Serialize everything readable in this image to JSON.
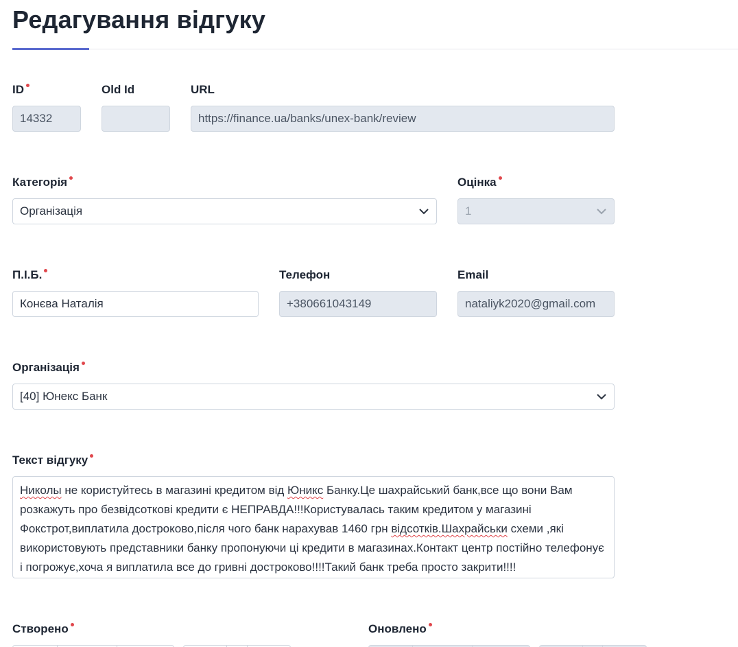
{
  "page": {
    "title": "Редагування відгуку"
  },
  "fields": {
    "id": {
      "label": "ID",
      "value": "14332"
    },
    "old_id": {
      "label": "Old Id",
      "value": ""
    },
    "url": {
      "label": "URL",
      "value": "https://finance.ua/banks/unex-bank/review"
    },
    "category": {
      "label": "Категорія",
      "value": "Організація"
    },
    "rating": {
      "label": "Оцінка",
      "value": "1"
    },
    "name": {
      "label": "П.І.Б.",
      "value": "Конєва Наталія"
    },
    "phone": {
      "label": "Телефон",
      "value": "+380661043149"
    },
    "email": {
      "label": "Email",
      "value": "nataliyk2020@gmail.com"
    },
    "organization": {
      "label": "Організація",
      "value": "[40] Юнекс Банк"
    },
    "review_text": {
      "label": "Текст відгуку",
      "w1": "Николы",
      "t1": " не користуйтесь в магазині кредитом від ",
      "w2": "Юникс",
      "t2": " Банку.Це шахрайський банк,все що вони Вам розкажуть про безвідсоткові кредити  є НЕПРАВДА!!!Користувалась таким кредитом у магазині Фокстрот,виплатила достроково,після чого банк нарахував 1460 грн ",
      "w3": "відсотків.Шахрайськи",
      "t3": " схеми ,які використовують представники банку  пропонуючи ці кредити в магазинах.Контакт центр постійно телефонує і погрожує,хоча я виплатила все до гривні достроково!!!!Такий банк треба просто закрити!!!!"
    },
    "created": {
      "label": "Створено"
    },
    "updated": {
      "label": "Оновлено"
    }
  },
  "icons": {
    "select_arrow": "chevron-down-icon"
  },
  "colors": {
    "accent": "#5a6acf",
    "required": "#e0474c",
    "readonly_bg": "#e3e8ef"
  }
}
